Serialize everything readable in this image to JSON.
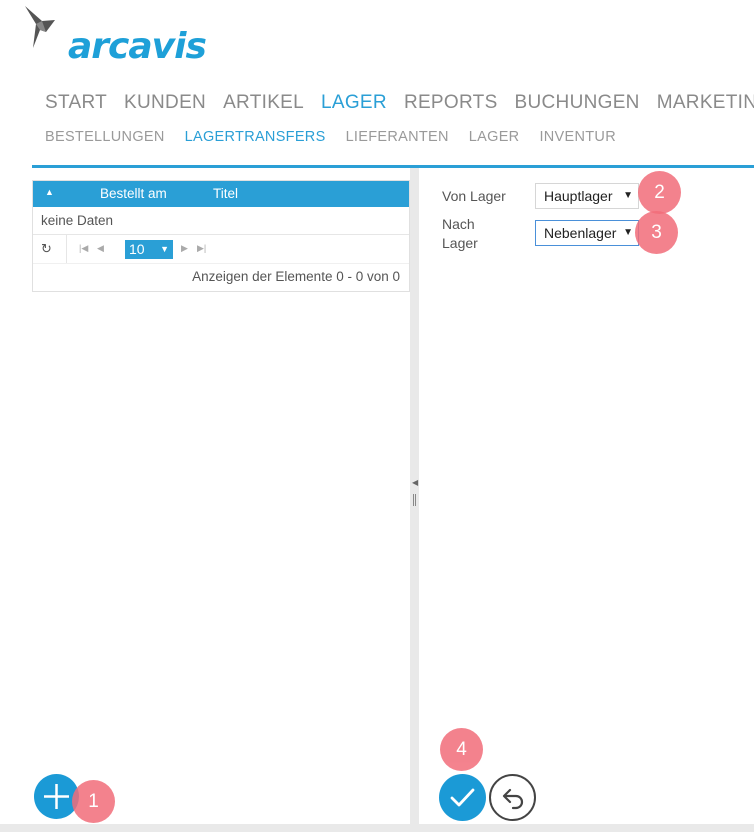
{
  "brand": {
    "name": "arcavis"
  },
  "main_nav": [
    {
      "label": "START",
      "active": false
    },
    {
      "label": "KUNDEN",
      "active": false
    },
    {
      "label": "ARTIKEL",
      "active": false
    },
    {
      "label": "LAGER",
      "active": true
    },
    {
      "label": "REPORTS",
      "active": false
    },
    {
      "label": "BUCHUNGEN",
      "active": false
    },
    {
      "label": "MARKETIN",
      "active": false
    }
  ],
  "sub_nav": [
    {
      "label": "BESTELLUNGEN",
      "active": false
    },
    {
      "label": "LAGERTRANSFERS",
      "active": true
    },
    {
      "label": "LIEFERANTEN",
      "active": false
    },
    {
      "label": "LAGER",
      "active": false
    },
    {
      "label": "INVENTUR",
      "active": false
    }
  ],
  "grid": {
    "columns": [
      "Bestellt am",
      "Titel"
    ],
    "empty_text": "keine Daten",
    "page_size": "10",
    "pager_info": "Anzeigen der Elemente 0 - 0 von 0"
  },
  "form": {
    "von_lager_label": "Von Lager",
    "von_lager_value": "Hauptlager",
    "nach_lager_label_line1": "Nach",
    "nach_lager_label_line2": "Lager",
    "nach_lager_value": "Nebenlager"
  },
  "callouts": {
    "c1": "1",
    "c2": "2",
    "c3": "3",
    "c4": "4"
  },
  "icons": {
    "add": "plus-icon",
    "confirm": "check-icon",
    "back": "undo-icon",
    "refresh": "refresh-icon",
    "sort": "sort-asc-icon"
  },
  "colors": {
    "accent": "#2a9fd6",
    "callout": "#f26d7a",
    "nav_text": "#8a8a8a"
  }
}
